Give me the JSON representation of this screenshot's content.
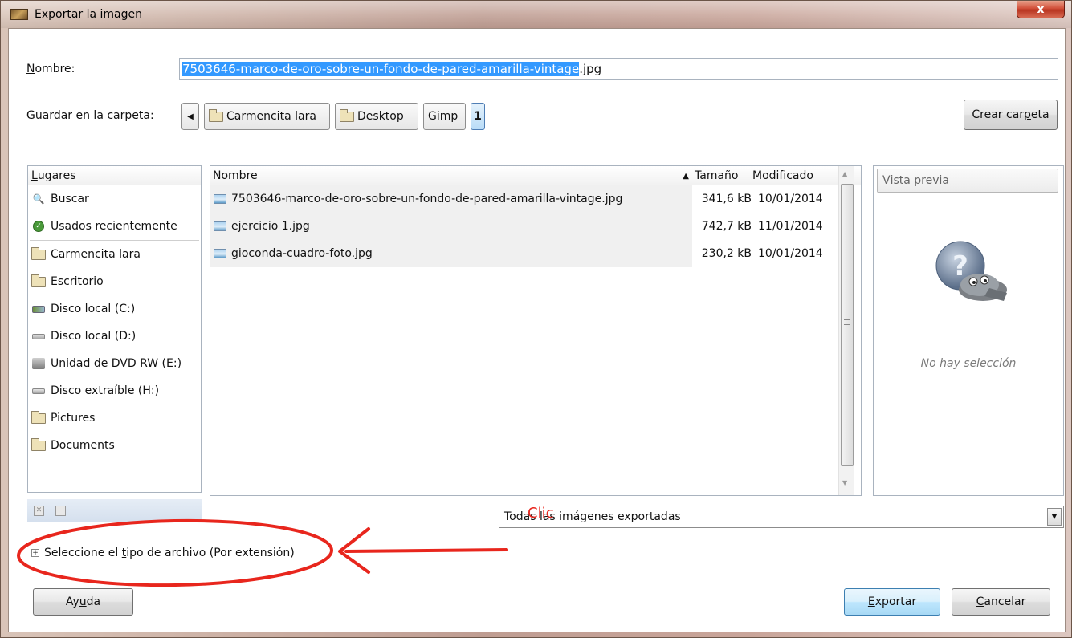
{
  "window": {
    "title": "Exportar la imagen",
    "close_glyph": "x"
  },
  "name_row": {
    "label_prefix": "",
    "label_underlined": "N",
    "label_rest": "ombre:",
    "selected_part": "7503646-marco-de-oro-sobre-un-fondo-de-pared-amarilla-vintage",
    "extension": ".jpg"
  },
  "folder_row": {
    "label_underlined": "G",
    "label_rest": "uardar en la carpeta:",
    "back_glyph": "◀",
    "crumbs": [
      "Carmencita lara",
      "Desktop",
      "Gimp",
      "1"
    ],
    "create_folder_pre": "Crear car",
    "create_folder_u": "p",
    "create_folder_post": "eta"
  },
  "places": {
    "header_u": "L",
    "header_rest": "ugares",
    "items": [
      {
        "label": "Buscar",
        "icon": "search-icon"
      },
      {
        "label": "Usados recientemente",
        "icon": "recent-icon"
      },
      {
        "label": "Carmencita lara",
        "icon": "folder-icon"
      },
      {
        "label": "Escritorio",
        "icon": "folder-icon"
      },
      {
        "label": "Disco local (C:)",
        "icon": "network-drive-icon"
      },
      {
        "label": "Disco local (D:)",
        "icon": "drive-icon"
      },
      {
        "label": "Unidad de DVD RW (E:)",
        "icon": "dvd-icon"
      },
      {
        "label": "Disco extraíble (H:)",
        "icon": "drive-icon"
      },
      {
        "label": "Pictures",
        "icon": "folder-icon"
      },
      {
        "label": "Documents",
        "icon": "folder-icon"
      }
    ]
  },
  "files": {
    "columns": {
      "name": "Nombre",
      "size": "Tamaño",
      "modified": "Modificado"
    },
    "rows": [
      {
        "name": "7503646-marco-de-oro-sobre-un-fondo-de-pared-amarilla-vintage.jpg",
        "size": "341,6 kB",
        "modified": "10/01/2014"
      },
      {
        "name": "ejercicio 1.jpg",
        "size": "742,7 kB",
        "modified": "11/01/2014"
      },
      {
        "name": "gioconda-cuadro-foto.jpg",
        "size": "230,2 kB",
        "modified": "10/01/2014"
      }
    ]
  },
  "preview": {
    "title_u": "V",
    "title_rest": "ista previa",
    "empty_text": "No hay selección"
  },
  "filter": {
    "selected": "Todas las imágenes exportadas"
  },
  "expander": {
    "pre": "Seleccione el ",
    "u": "t",
    "post": "ipo de archivo (Por extensión)"
  },
  "annotation": {
    "text": "Clic",
    "color": "#e8261d"
  },
  "buttons": {
    "help_pre": "Ay",
    "help_u": "u",
    "help_post": "da",
    "export_u": "E",
    "export_rest": "xportar",
    "cancel_u": "C",
    "cancel_rest": "ancelar"
  }
}
